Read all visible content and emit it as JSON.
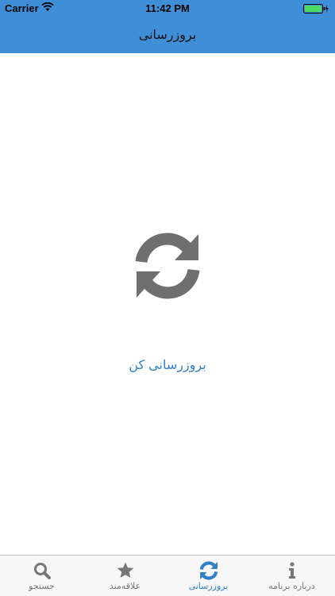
{
  "status_bar": {
    "carrier": "Carrier",
    "time": "11:42 PM",
    "wifi_icon": "wifi-icon",
    "battery_icon": "battery-icon"
  },
  "nav_bar": {
    "title": "بروزرسانی",
    "color": "#3f8fd8"
  },
  "main": {
    "refresh_icon": "refresh-icon",
    "refresh_link": "بروزرسانی کن",
    "link_color": "#2f80c9"
  },
  "tab_bar": {
    "active_index": 2,
    "tabs": [
      {
        "label": "جستجو",
        "icon": "search-icon"
      },
      {
        "label": "علاقه‌مند",
        "icon": "star-icon"
      },
      {
        "label": "بروزرسانی",
        "icon": "refresh-icon"
      },
      {
        "label": "درباره برنامه",
        "icon": "info-icon"
      }
    ]
  }
}
